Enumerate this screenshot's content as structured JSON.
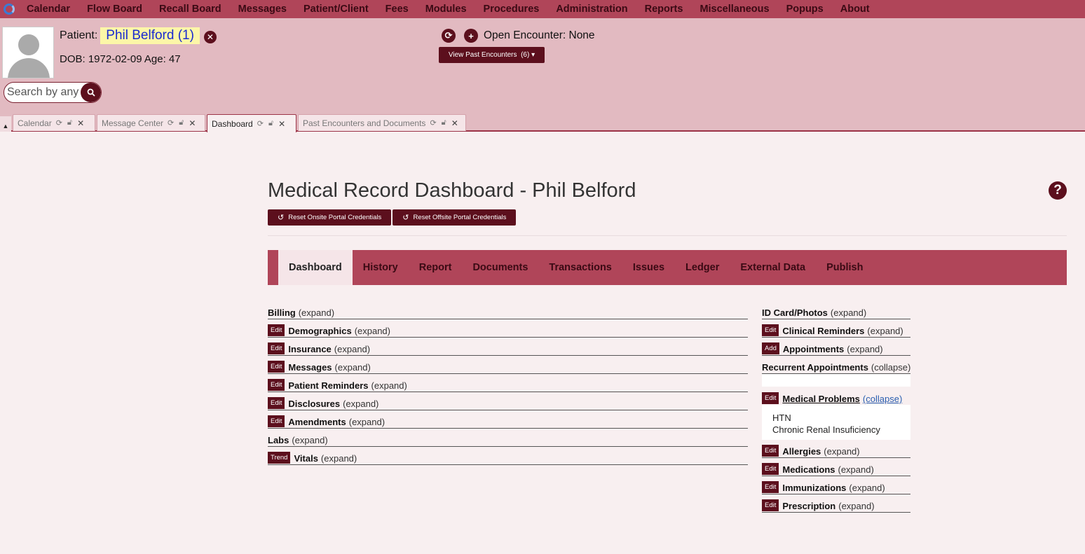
{
  "menu": [
    "Calendar",
    "Flow Board",
    "Recall Board",
    "Messages",
    "Patient/Client",
    "Fees",
    "Modules",
    "Procedures",
    "Administration",
    "Reports",
    "Miscellaneous",
    "Popups",
    "About"
  ],
  "patient": {
    "label": "Patient:",
    "name": "Phil Belford (1)",
    "dob_age": "DOB: 1972-02-09 Age: 47"
  },
  "search": {
    "placeholder": "Search by any"
  },
  "encounter": {
    "open_text": "Open Encounter: None",
    "past_button": "View Past Encounters",
    "past_count": "(6)"
  },
  "tabs": [
    {
      "label": "Calendar"
    },
    {
      "label": "Message Center"
    },
    {
      "label": "Dashboard"
    },
    {
      "label": "Past Encounters and Documents"
    }
  ],
  "main": {
    "title": "Medical Record Dashboard - Phil Belford",
    "reset_onsite": "Reset Onsite Portal Credentials",
    "reset_offsite": "Reset Offsite Portal Credentials",
    "nav": [
      "Dashboard",
      "History",
      "Report",
      "Documents",
      "Transactions",
      "Issues",
      "Ledger",
      "External Data",
      "Publish"
    ]
  },
  "left_sections": [
    {
      "badge": "",
      "title": "Billing",
      "state": "(expand)"
    },
    {
      "badge": "Edit",
      "title": "Demographics",
      "state": "(expand)"
    },
    {
      "badge": "Edit",
      "title": "Insurance",
      "state": "(expand)"
    },
    {
      "badge": "Edit",
      "title": "Messages",
      "state": "(expand)"
    },
    {
      "badge": "Edit",
      "title": "Patient Reminders",
      "state": "(expand)"
    },
    {
      "badge": "Edit",
      "title": "Disclosures",
      "state": "(expand)"
    },
    {
      "badge": "Edit",
      "title": "Amendments",
      "state": "(expand)"
    },
    {
      "badge": "",
      "title": "Labs",
      "state": "(expand)"
    },
    {
      "badge": "Trend",
      "title": "Vitals",
      "state": "(expand)"
    }
  ],
  "right_sections": {
    "id_card": {
      "title": "ID Card/Photos",
      "state": "(expand)"
    },
    "clinical": {
      "badge": "Edit",
      "title": "Clinical Reminders",
      "state": "(expand)"
    },
    "appointments": {
      "badge": "Add",
      "title": "Appointments",
      "state": "(expand)"
    },
    "recurrent": {
      "title": "Recurrent Appointments",
      "state": "(collapse)"
    },
    "problems": {
      "badge": "Edit",
      "title": "Medical Problems",
      "state": "(collapse)",
      "items": [
        "HTN",
        "Chronic Renal Insuficiency"
      ]
    },
    "allergies": {
      "badge": "Edit",
      "title": "Allergies",
      "state": "(expand)"
    },
    "medications": {
      "badge": "Edit",
      "title": "Medications",
      "state": "(expand)"
    },
    "immunizations": {
      "badge": "Edit",
      "title": "Immunizations",
      "state": "(expand)"
    },
    "prescription": {
      "badge": "Edit",
      "title": "Prescription",
      "state": "(expand)"
    }
  }
}
